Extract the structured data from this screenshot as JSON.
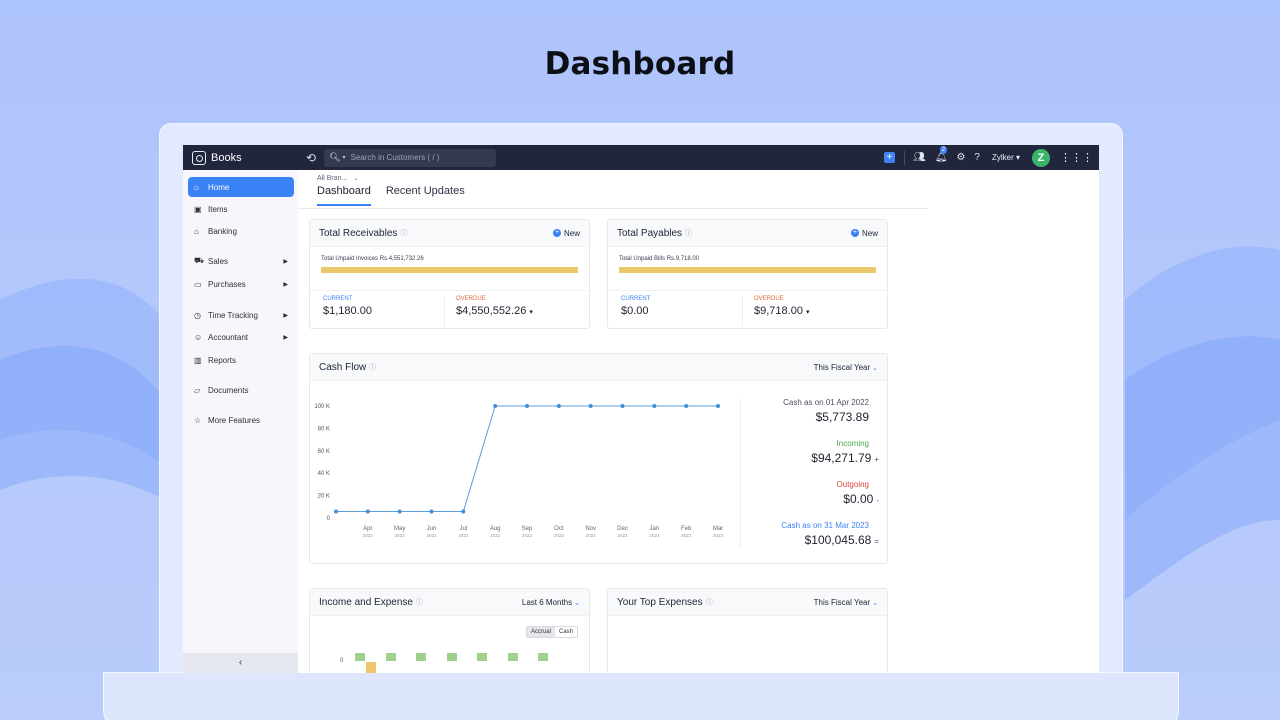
{
  "page_heading": "Dashboard",
  "app": {
    "brand": "Books",
    "search_placeholder": "Search in Customers ( / )",
    "notification_count": "2",
    "org_name": "Zylker",
    "avatar_letter": "Z"
  },
  "sidebar": {
    "items": [
      {
        "label": "Home",
        "icon": "home-icon",
        "active": true,
        "has_arrow": false
      },
      {
        "label": "Items",
        "icon": "box-icon",
        "active": false,
        "has_arrow": false
      },
      {
        "label": "Banking",
        "icon": "bank-icon",
        "active": false,
        "has_arrow": false
      },
      {
        "label": "Sales",
        "icon": "cart-icon",
        "active": false,
        "has_arrow": true
      },
      {
        "label": "Purchases",
        "icon": "bag-icon",
        "active": false,
        "has_arrow": true
      },
      {
        "label": "Time Tracking",
        "icon": "clock-icon",
        "active": false,
        "has_arrow": true
      },
      {
        "label": "Accountant",
        "icon": "person-icon",
        "active": false,
        "has_arrow": true
      },
      {
        "label": "Reports",
        "icon": "bar-chart-icon",
        "active": false,
        "has_arrow": false
      },
      {
        "label": "Documents",
        "icon": "folder-icon",
        "active": false,
        "has_arrow": false
      },
      {
        "label": "More Features",
        "icon": "star-icon",
        "active": false,
        "has_arrow": false
      }
    ],
    "collapse_label": "‹"
  },
  "content": {
    "branch_selector": "All Bran...",
    "tabs": [
      {
        "label": "Dashboard",
        "active": true
      },
      {
        "label": "Recent Updates",
        "active": false
      }
    ]
  },
  "receivables": {
    "title": "Total Receivables",
    "new_label": "New",
    "unpaid_text": "Total Unpaid Invoices Rs.4,551,732.26",
    "current_label": "CURRENT",
    "current_value": "$1,180.00",
    "overdue_label": "OVERDUE",
    "overdue_value": "$4,550,552.26"
  },
  "payables": {
    "title": "Total Payables",
    "new_label": "New",
    "unpaid_text": "Total Unpaid Bills Rs.9,718.00",
    "current_label": "CURRENT",
    "current_value": "$0.00",
    "overdue_label": "OVERDUE",
    "overdue_value": "$9,718.00"
  },
  "cash_flow": {
    "title": "Cash Flow",
    "period": "This Fiscal Year",
    "opening_label": "Cash as on 01 Apr 2022",
    "opening_value": "$5,773.89",
    "incoming_label": "Incoming",
    "incoming_value": "$94,271.79",
    "incoming_sign": "+",
    "outgoing_label": "Outgoing",
    "outgoing_value": "$0.00",
    "outgoing_sign": "-",
    "closing_label": "Cash as on 31 Mar 2023",
    "closing_value": "$100,045.68",
    "closing_sign": "=",
    "colors": {
      "line": "#5aa0dd",
      "point": "#3f8fd8"
    }
  },
  "chart_data": {
    "type": "line",
    "x": [
      "Mar",
      "Apr",
      "May",
      "Jun",
      "Jul",
      "Aug",
      "Sep",
      "Oct",
      "Nov",
      "Dec",
      "Jan",
      "Feb",
      "Mar"
    ],
    "x_years": [
      "",
      "2022",
      "2022",
      "2022",
      "2022",
      "2022",
      "2022",
      "2022",
      "2022",
      "2022",
      "2023",
      "2023",
      "2023"
    ],
    "y": [
      5773.89,
      5773.89,
      5773.89,
      5773.89,
      5773.89,
      100045.68,
      100045.68,
      100045.68,
      100045.68,
      100045.68,
      100045.68,
      100045.68,
      100045.68
    ],
    "y_ticks": [
      "0",
      "20 K",
      "40 K",
      "60 K",
      "80 K",
      "100 K"
    ],
    "ylim": [
      0,
      100000
    ],
    "grid": false
  },
  "income_expense": {
    "title": "Income and Expense",
    "period": "Last 6 Months",
    "toggle_accrual": "Accrual",
    "toggle_cash": "Cash",
    "zero_label": "0",
    "colors": {
      "income": "#9fd08e",
      "expense": "#efc56e"
    }
  },
  "top_expenses": {
    "title": "Your Top Expenses",
    "period": "This Fiscal Year"
  }
}
